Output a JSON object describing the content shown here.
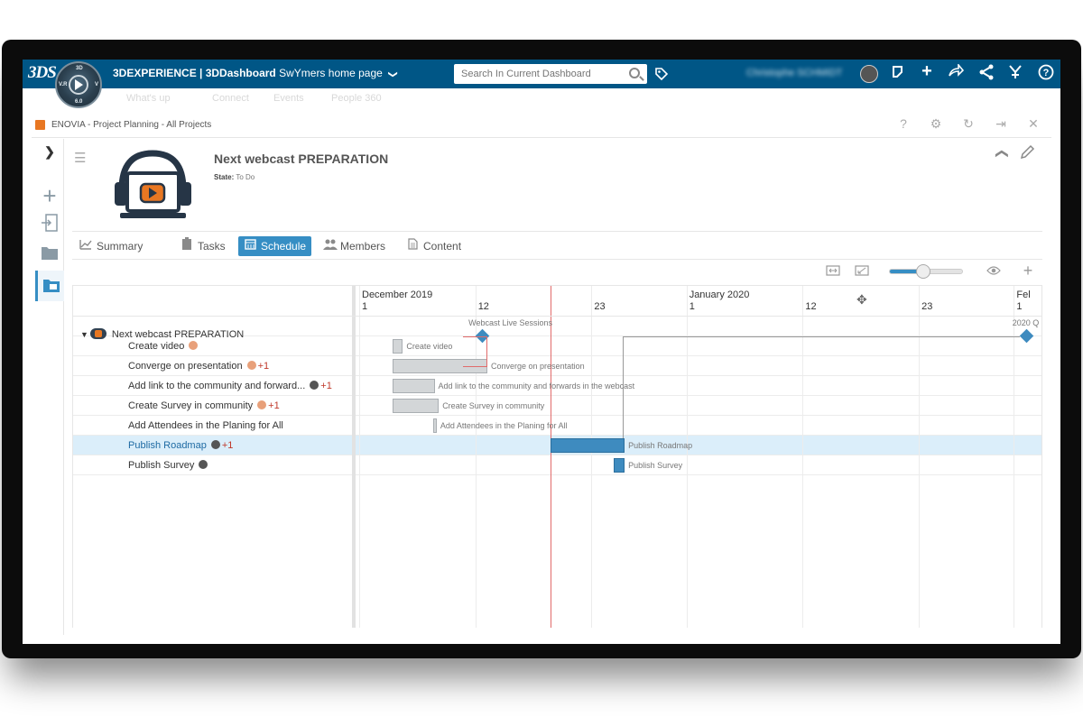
{
  "topbar": {
    "logo": "3DS",
    "compass": {
      "top": "3D",
      "left": "V.R",
      "right": "V",
      "bottom": "6.0"
    },
    "brand_bold": "3DEXPERIENCE | 3DDashboard",
    "brand_page": "SwYmers home page",
    "chevron": "❯",
    "search_placeholder": "Search In Current Dashboard",
    "user_name": "Christophe SCHMIDT",
    "icons": [
      "tag-icon",
      "share-icon",
      "plus-icon",
      "forward-icon",
      "network-icon",
      "compass-icon",
      "help-icon"
    ]
  },
  "subnav": [
    "What's up",
    "Connect",
    "Events",
    "People 360"
  ],
  "widget": {
    "title": "ENOVIA - Project Planning - All Projects",
    "controls": [
      "?",
      "⚙",
      "↻",
      "⇥",
      "✕"
    ]
  },
  "project": {
    "title": "Next webcast PREPARATION",
    "state_label": "State:",
    "state_value": "To Do"
  },
  "tabs": [
    {
      "label": "Summary",
      "icon": "chart-icon",
      "glyph": "📈",
      "active": false
    },
    {
      "label": "Tasks",
      "icon": "clipboard-icon",
      "glyph": "📋",
      "active": false
    },
    {
      "label": "Schedule",
      "icon": "calendar-icon",
      "glyph": "▦",
      "active": true
    },
    {
      "label": "Members",
      "icon": "people-icon",
      "glyph": "👥",
      "active": false
    },
    {
      "label": "Content",
      "icon": "document-icon",
      "glyph": "📄",
      "active": false
    }
  ],
  "toolbar": {
    "zoom_level": 0.45
  },
  "gantt": {
    "months": [
      {
        "label": "December 2019",
        "day": 1
      },
      {
        "label": "January 2020",
        "day": 32
      },
      {
        "label": "Fel",
        "day": 63
      }
    ],
    "days": [
      {
        "label": "1",
        "day": 1
      },
      {
        "label": "12",
        "day": 12
      },
      {
        "label": "23",
        "day": 23
      },
      {
        "label": "1",
        "day": 32
      },
      {
        "label": "12",
        "day": 43
      },
      {
        "label": "23",
        "day": 54
      },
      {
        "label": "1",
        "day": 63
      }
    ],
    "today_day": 17.6,
    "project_row": {
      "name": "Next webcast PREPARATION"
    },
    "milestones": [
      {
        "label": "Webcast Live Sessions",
        "day": 10.5
      },
      {
        "label": "2020 Q",
        "day": 62
      }
    ],
    "tasks": [
      {
        "name": "Create video",
        "avatar": "face",
        "extra": "",
        "start": 2.6,
        "end": 3.6,
        "label": "Create video",
        "color": "#d3d6d8",
        "selected": false
      },
      {
        "name": "Converge on presentation",
        "avatar": "face",
        "extra": "+1",
        "start": 2.6,
        "end": 11.6,
        "label": "Converge on presentation",
        "color": "#d3d6d8",
        "selected": false
      },
      {
        "name": "Add link to the community and forward...",
        "avatar": "dark",
        "extra": "+1",
        "start": 2.6,
        "end": 6.6,
        "label": "Add link to the community and forwards in the webcast",
        "color": "#d3d6d8",
        "selected": false
      },
      {
        "name": "Create Survey in community",
        "avatar": "face",
        "extra": "+1",
        "start": 2.6,
        "end": 7,
        "label": "Create Survey in community",
        "color": "#d3d6d8",
        "selected": false
      },
      {
        "name": "Add Attendees in the Planing for All",
        "avatar": "",
        "extra": "",
        "start": 6.5,
        "end": 6.8,
        "label": "Add Attendees in the Planing for All",
        "color": "#d3d6d8",
        "selected": false
      },
      {
        "name": "Publish Roadmap",
        "avatar": "dark",
        "extra": "+1",
        "start": 17.6,
        "end": 24.6,
        "label": "Publish Roadmap",
        "color": "#3e8bbf",
        "selected": true
      },
      {
        "name": "Publish Survey",
        "avatar": "dark",
        "extra": "",
        "start": 23.6,
        "end": 24.6,
        "label": "Publish Survey",
        "color": "#3e8bbf",
        "selected": false
      }
    ]
  }
}
